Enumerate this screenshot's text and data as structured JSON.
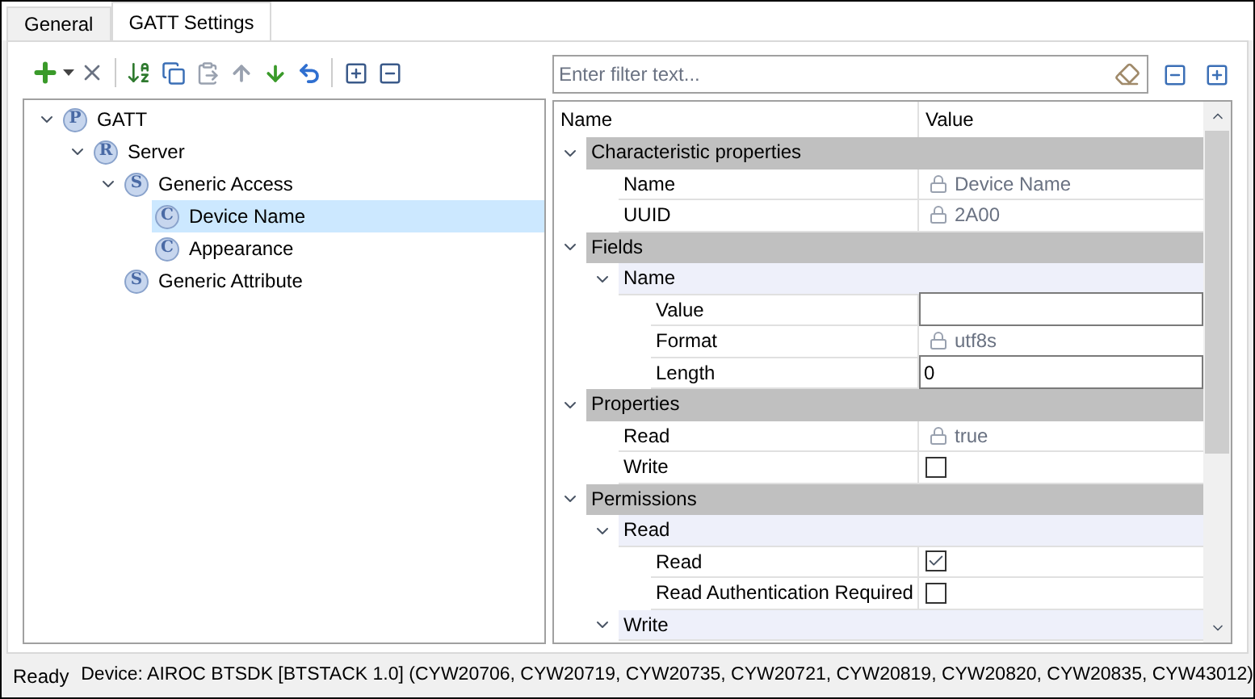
{
  "tabs": [
    {
      "label": "General",
      "selected": false
    },
    {
      "label": "GATT Settings",
      "selected": true
    }
  ],
  "tree": [
    {
      "label": "GATT",
      "badge": "P",
      "expanded": true,
      "selected": false,
      "children": [
        {
          "label": "Server",
          "badge": "R",
          "expanded": true,
          "selected": false,
          "children": [
            {
              "label": "Generic Access",
              "badge": "S",
              "expanded": true,
              "selected": false,
              "children": [
                {
                  "label": "Device Name",
                  "badge": "C",
                  "selected": true
                },
                {
                  "label": "Appearance",
                  "badge": "C",
                  "selected": false
                }
              ]
            },
            {
              "label": "Generic Attribute",
              "badge": "S",
              "selected": false
            }
          ]
        }
      ]
    }
  ],
  "filter": {
    "placeholder": "Enter filter text..."
  },
  "table": {
    "columns": [
      "Name",
      "Value"
    ],
    "rows": [
      {
        "kind": "group",
        "label": "Characteristic properties",
        "expanded": true,
        "children": [
          {
            "kind": "locked",
            "label": "Name",
            "value": "Device Name"
          },
          {
            "kind": "locked",
            "label": "UUID",
            "value": "2A00"
          }
        ]
      },
      {
        "kind": "group",
        "label": "Fields",
        "expanded": true,
        "children": [
          {
            "kind": "subgroup",
            "label": "Name",
            "expanded": true,
            "children": [
              {
                "kind": "input",
                "label": "Value"
              },
              {
                "kind": "locked",
                "label": "Format",
                "value": "utf8s"
              },
              {
                "kind": "input",
                "label": "Length",
                "value": "0"
              }
            ]
          }
        ]
      },
      {
        "kind": "group",
        "label": "Properties",
        "expanded": true,
        "children": [
          {
            "kind": "locked",
            "label": "Read",
            "value": "true"
          },
          {
            "kind": "checkbox",
            "label": "Write",
            "checked": false
          }
        ]
      },
      {
        "kind": "group",
        "label": "Permissions",
        "expanded": true,
        "children": [
          {
            "kind": "subgroup",
            "label": "Read",
            "expanded": true,
            "children": [
              {
                "kind": "checkbox",
                "label": "Read",
                "checked": true
              },
              {
                "kind": "checkbox",
                "label": "Read Authentication Required",
                "checked": false
              }
            ]
          },
          {
            "kind": "subgroup",
            "label": "Write",
            "expanded": true
          }
        ]
      }
    ]
  },
  "status_bar": {
    "state": "Ready",
    "device": "Device: AIROC BTSDK [BTSTACK 1.0] (CYW20706, CYW20719, CYW20735, CYW20721, CYW20819, CYW20820, CYW20835, CYW43012)"
  }
}
